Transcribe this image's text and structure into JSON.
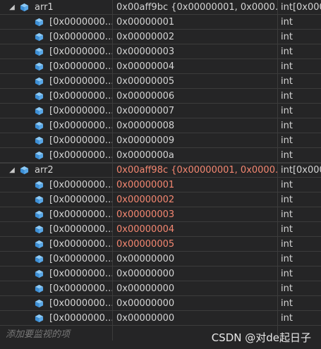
{
  "watch": {
    "groups": [
      {
        "name": "arr1",
        "value": "0x00aff9bc {0x00000001, 0x0000...",
        "type": "int[0x000",
        "value_changed": false,
        "items": [
          {
            "name": "[0x0000000...",
            "value": "0x00000001",
            "type": "int",
            "changed": false
          },
          {
            "name": "[0x0000000...",
            "value": "0x00000002",
            "type": "int",
            "changed": false
          },
          {
            "name": "[0x0000000...",
            "value": "0x00000003",
            "type": "int",
            "changed": false
          },
          {
            "name": "[0x0000000...",
            "value": "0x00000004",
            "type": "int",
            "changed": false
          },
          {
            "name": "[0x0000000...",
            "value": "0x00000005",
            "type": "int",
            "changed": false
          },
          {
            "name": "[0x0000000...",
            "value": "0x00000006",
            "type": "int",
            "changed": false
          },
          {
            "name": "[0x0000000...",
            "value": "0x00000007",
            "type": "int",
            "changed": false
          },
          {
            "name": "[0x0000000...",
            "value": "0x00000008",
            "type": "int",
            "changed": false
          },
          {
            "name": "[0x0000000...",
            "value": "0x00000009",
            "type": "int",
            "changed": false
          },
          {
            "name": "[0x0000000...",
            "value": "0x0000000a",
            "type": "int",
            "changed": false
          }
        ]
      },
      {
        "name": "arr2",
        "value": "0x00aff98c {0x00000001, 0x0000...",
        "type": "int[0x000",
        "value_changed": true,
        "items": [
          {
            "name": "[0x0000000...",
            "value": "0x00000001",
            "type": "int",
            "changed": true
          },
          {
            "name": "[0x0000000...",
            "value": "0x00000002",
            "type": "int",
            "changed": true
          },
          {
            "name": "[0x0000000...",
            "value": "0x00000003",
            "type": "int",
            "changed": true
          },
          {
            "name": "[0x0000000...",
            "value": "0x00000004",
            "type": "int",
            "changed": true
          },
          {
            "name": "[0x0000000...",
            "value": "0x00000005",
            "type": "int",
            "changed": true
          },
          {
            "name": "[0x0000000...",
            "value": "0x00000000",
            "type": "int",
            "changed": false
          },
          {
            "name": "[0x0000000...",
            "value": "0x00000000",
            "type": "int",
            "changed": false
          },
          {
            "name": "[0x0000000...",
            "value": "0x00000000",
            "type": "int",
            "changed": false
          },
          {
            "name": "[0x0000000...",
            "value": "0x00000000",
            "type": "int",
            "changed": false
          },
          {
            "name": "[0x0000000...",
            "value": "0x00000000",
            "type": "int",
            "changed": false
          }
        ]
      }
    ],
    "add_placeholder": "添加要监视的项",
    "expander_icon": "triangle-expanded-icon",
    "item_icon": "cube-field-icon"
  },
  "watermark": "CSDN @对de起日子",
  "colors": {
    "background": "#252526",
    "grid_line": "#3c3c3c",
    "text": "#d4d4d4",
    "changed_value": "#f48771",
    "cube_icon": "#59a8e8",
    "placeholder": "#7a7a7a"
  }
}
